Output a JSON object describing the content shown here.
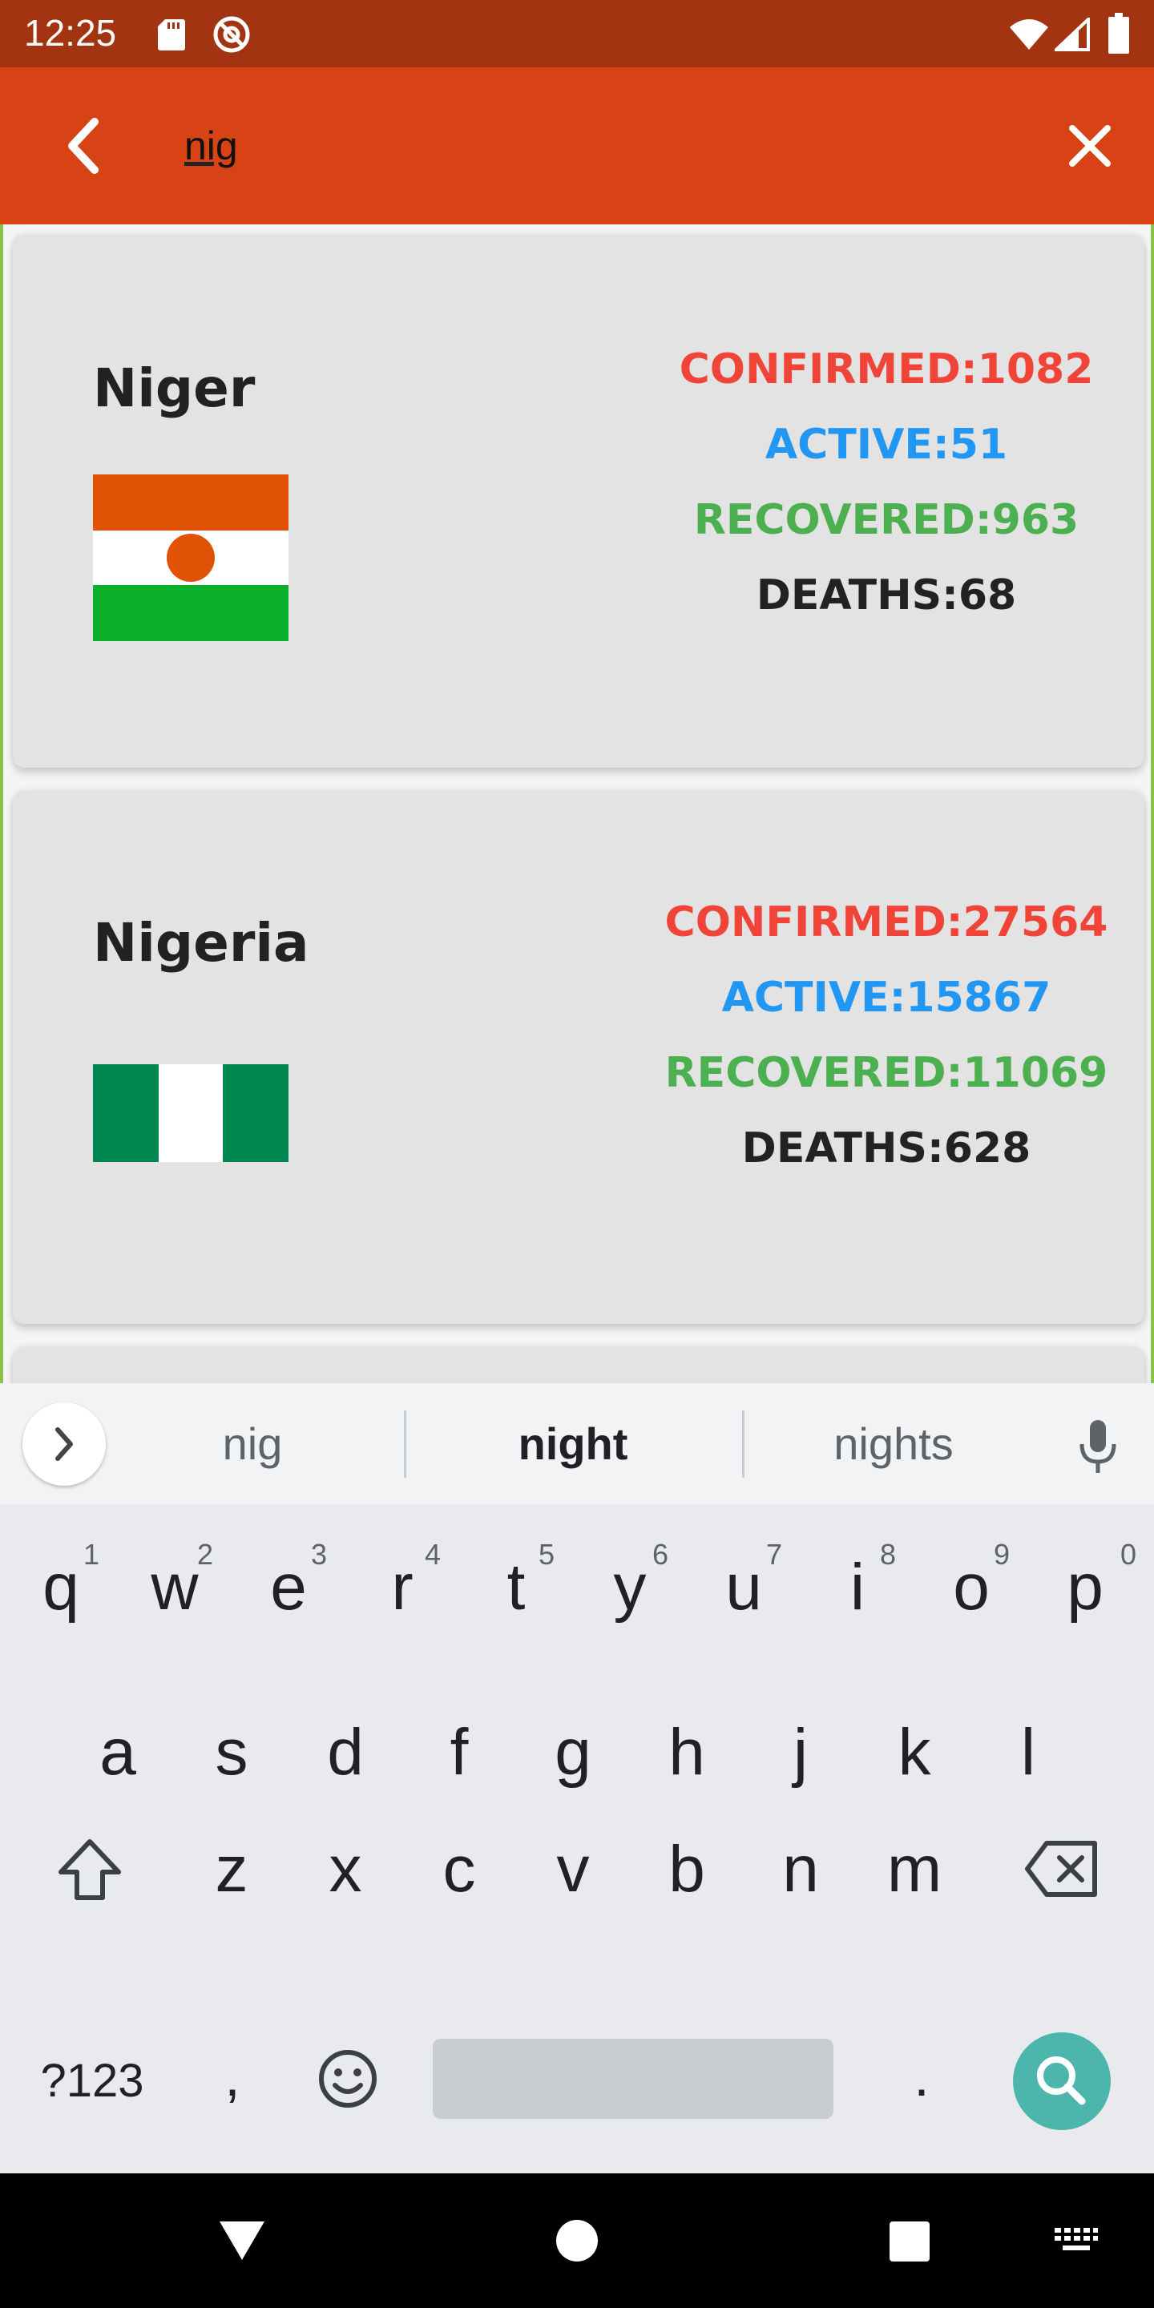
{
  "status_bar": {
    "time": "12:25",
    "icons": [
      "sd-card-icon",
      "at-sign-icon",
      "wifi-icon",
      "signal-icon",
      "battery-icon"
    ]
  },
  "toolbar": {
    "search_value": "nig",
    "back_icon": "back-arrow-icon",
    "clear_icon": "close-icon",
    "color": "#d84315"
  },
  "countries": [
    {
      "name": "Niger",
      "flag": "niger-flag",
      "confirmed": "CONFIRMED:1082",
      "active": "ACTIVE:51",
      "recovered": "RECOVERED:963",
      "deaths": "DEATHS:68"
    },
    {
      "name": "Nigeria",
      "flag": "nigeria-flag",
      "confirmed": "CONFIRMED:27564",
      "active": "ACTIVE:15867",
      "recovered": "RECOVERED:11069",
      "deaths": "DEATHS:628"
    }
  ],
  "stat_colors": {
    "confirmed": "#f04438",
    "active": "#2196f3",
    "recovered": "#4caf50",
    "deaths": "#222222"
  },
  "keyboard": {
    "suggestions": [
      "nig",
      "night",
      "nights"
    ],
    "row1": [
      {
        "key": "q",
        "hint": "1"
      },
      {
        "key": "w",
        "hint": "2"
      },
      {
        "key": "e",
        "hint": "3"
      },
      {
        "key": "r",
        "hint": "4"
      },
      {
        "key": "t",
        "hint": "5"
      },
      {
        "key": "y",
        "hint": "6"
      },
      {
        "key": "u",
        "hint": "7"
      },
      {
        "key": "i",
        "hint": "8"
      },
      {
        "key": "o",
        "hint": "9"
      },
      {
        "key": "p",
        "hint": "0"
      }
    ],
    "row2": [
      "a",
      "s",
      "d",
      "f",
      "g",
      "h",
      "j",
      "k",
      "l"
    ],
    "row3": [
      "z",
      "x",
      "c",
      "v",
      "b",
      "n",
      "m"
    ],
    "symbols_label": "?123",
    "comma": ",",
    "period": ".",
    "action_icon": "search-icon",
    "action_color": "#4db6ac"
  },
  "nav_bar": {
    "icons": [
      "back-triangle-icon",
      "home-circle-icon",
      "recents-square-icon",
      "keyboard-switch-icon"
    ]
  }
}
